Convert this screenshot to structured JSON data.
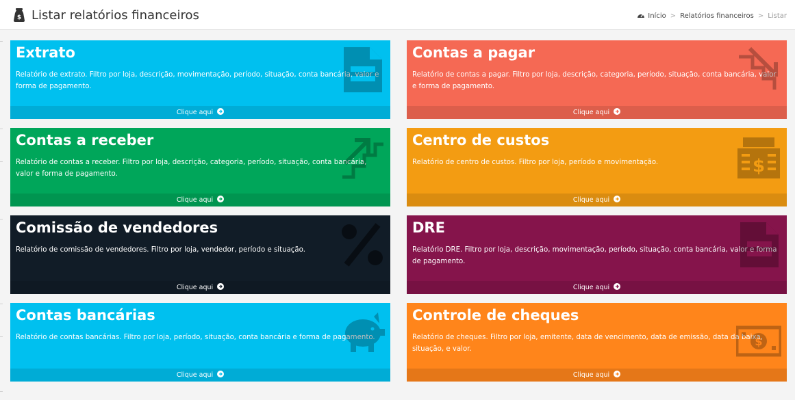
{
  "header": {
    "title": "Listar relatórios financeiros",
    "icon": "money-bag-icon",
    "breadcrumb": {
      "home": "Início",
      "section": "Relatórios financeiros",
      "current": "Listar",
      "separator": ">"
    }
  },
  "boxes": [
    {
      "title": "Extrato",
      "description": "Relatório de extrato. Filtro por loja, descrição, movimentação, período, situação, conta bancária, valor e forma de pagamento.",
      "link": "Clique aqui",
      "color": "#00c0ef",
      "icon": "document-icon"
    },
    {
      "title": "Contas a pagar",
      "description": "Relatório de contas a pagar. Filtro por loja, descrição, categoria, período, situação, conta bancária, valor e forma de pagamento.",
      "link": "Clique aqui",
      "color": "#f56954",
      "icon": "trend-down-icon"
    },
    {
      "title": "Contas a receber",
      "description": "Relatório de contas a receber. Filtro por loja, descrição, categoria, período, situação, conta bancária, valor e forma de pagamento.",
      "link": "Clique aqui",
      "color": "#00a65a",
      "icon": "trend-up-icon"
    },
    {
      "title": "Centro de custos",
      "description": "Relatório de centro de custos. Filtro por loja, período e movimentação.",
      "link": "Clique aqui",
      "color": "#f39c12",
      "icon": "cash-register-icon"
    },
    {
      "title": "Comissão de vendedores",
      "description": "Relatório de comissão de vendedores. Filtro por loja, vendedor, período e situação.",
      "link": "Clique aqui",
      "color": "#111c27",
      "icon": "percent-icon"
    },
    {
      "title": "DRE",
      "description": "Relatório DRE. Filtro por loja, descrição, movimentação, período, situação, conta bancária, valor e forma de pagamento.",
      "link": "Clique aqui",
      "color": "#85144b",
      "icon": "document-icon"
    },
    {
      "title": "Contas bancárias",
      "description": "Relatório de contas bancárias. Filtro por loja, período, situação, conta bancária e forma de pagamento.",
      "link": "Clique aqui",
      "color": "#00c0ef",
      "icon": "piggy-bank-icon"
    },
    {
      "title": "Controle de cheques",
      "description": "Relatório de cheques. Filtro por loja, emitente, data de vencimento, data de emissão, data da baixa, situação, e valor.",
      "link": "Clique aqui",
      "color": "#ff851b",
      "icon": "money-bill-icon"
    }
  ]
}
